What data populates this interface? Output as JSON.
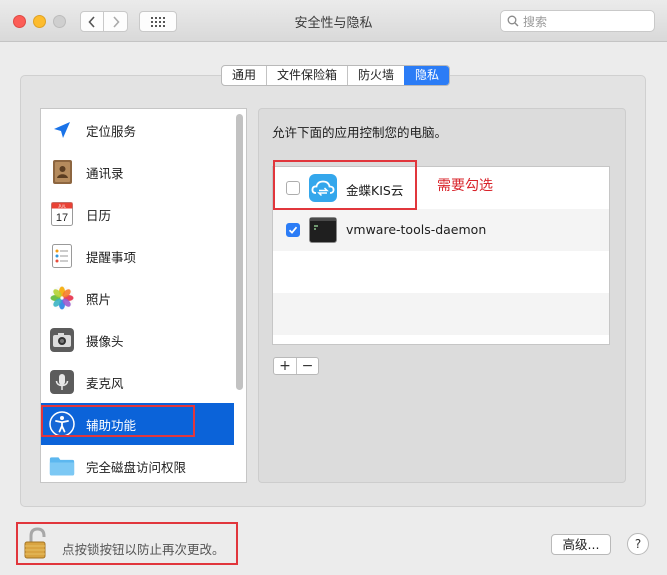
{
  "window": {
    "title": "安全性与隐私"
  },
  "search": {
    "placeholder": "搜索"
  },
  "tabs": [
    {
      "label": "通用",
      "active": false
    },
    {
      "label": "文件保险箱",
      "active": false
    },
    {
      "label": "防火墙",
      "active": false
    },
    {
      "label": "隐私",
      "active": true
    }
  ],
  "sidebar": {
    "items": [
      {
        "label": "定位服务",
        "icon": "location-arrow-icon"
      },
      {
        "label": "通讯录",
        "icon": "contacts-book-icon"
      },
      {
        "label": "日历",
        "icon": "calendar-icon",
        "icon_month": "JUL",
        "icon_day": "17"
      },
      {
        "label": "提醒事项",
        "icon": "reminders-icon"
      },
      {
        "label": "照片",
        "icon": "photos-icon"
      },
      {
        "label": "摄像头",
        "icon": "camera-icon"
      },
      {
        "label": "麦克风",
        "icon": "microphone-icon"
      },
      {
        "label": "辅助功能",
        "icon": "accessibility-icon",
        "selected": true
      },
      {
        "label": "完全磁盘访问权限",
        "icon": "folder-icon"
      }
    ]
  },
  "main": {
    "instruction": "允许下面的应用控制您的电脑。",
    "apps": [
      {
        "name": "金蝶KIS云",
        "checked": false,
        "icon": "kingdee-cloud-icon"
      },
      {
        "name": "vmware-tools-daemon",
        "checked": true,
        "icon": "terminal-icon"
      }
    ],
    "add_label": "+",
    "remove_label": "−"
  },
  "annotation": {
    "note": "需要勾选",
    "color": "#e1363c"
  },
  "footer": {
    "lock_text": "点按锁按钮以防止再次更改。",
    "advanced_label": "高级...",
    "help_label": "?"
  },
  "colors": {
    "accent": "#2b7cf6",
    "selection": "#0b63d9"
  }
}
